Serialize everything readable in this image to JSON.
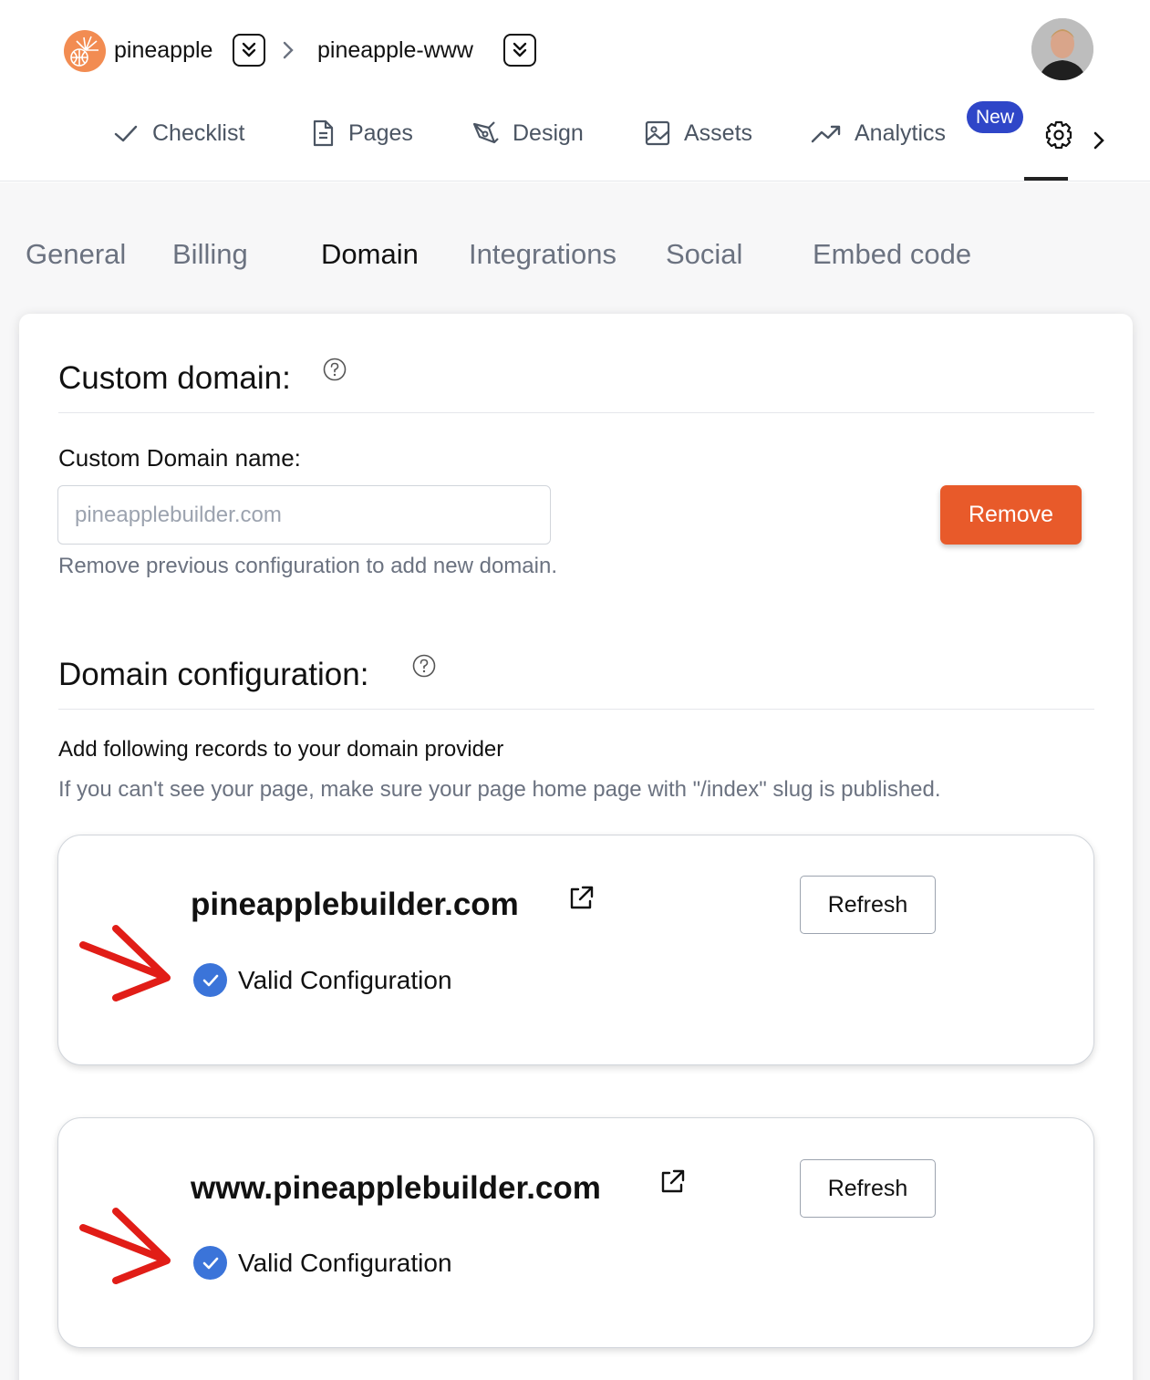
{
  "colors": {
    "accent_remove": "#e85a2a",
    "badge_new": "#2f46c8",
    "valid_check": "#3b74d9",
    "annotation_arrow": "#e11d17"
  },
  "breadcrumb": {
    "project": "pineapple",
    "site": "pineapple-www",
    "switch_icon": "chevrons-down-icon",
    "separator_icon": "chevron-right-icon"
  },
  "nav": {
    "items": [
      {
        "label": "Checklist",
        "icon": "check-icon"
      },
      {
        "label": "Pages",
        "icon": "page-icon"
      },
      {
        "label": "Design",
        "icon": "pen-tool-icon"
      },
      {
        "label": "Assets",
        "icon": "image-icon"
      },
      {
        "label": "Analytics",
        "icon": "trending-up-icon"
      }
    ],
    "new_badge": "New",
    "active_icon": "gear-icon",
    "next_icon": "chevron-right-icon"
  },
  "subtabs": {
    "items": [
      "General",
      "Billing",
      "Domain",
      "Integrations",
      "Social",
      "Embed code"
    ],
    "active": "Domain"
  },
  "custom_domain": {
    "title": "Custom domain:",
    "label": "Custom Domain name:",
    "placeholder": "pineapplebuilder.com",
    "hint": "Remove previous configuration to add new domain.",
    "remove_label": "Remove"
  },
  "domain_config": {
    "title": "Domain configuration:",
    "description": "Add following records to your domain provider",
    "sub_description": "If you can't see your page, make sure your page home page with \"/index\" slug is published.",
    "domains": [
      {
        "name": "pineapplebuilder.com",
        "refresh_label": "Refresh",
        "status": "Valid Configuration"
      },
      {
        "name": "www.pineapplebuilder.com",
        "refresh_label": "Refresh",
        "status": "Valid Configuration"
      }
    ]
  }
}
